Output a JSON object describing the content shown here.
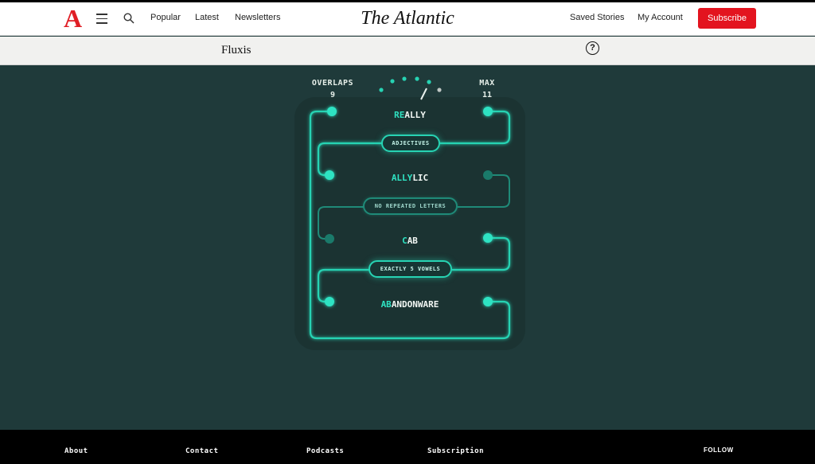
{
  "header": {
    "logo": "A",
    "nav": [
      "Popular",
      "Latest",
      "Newsletters"
    ],
    "brand": "The Atlantic",
    "saved_stories": "Saved Stories",
    "my_account": "My Account",
    "subscribe": "Subscribe"
  },
  "subheader": {
    "title": "Fluxis",
    "help": "?"
  },
  "game": {
    "overlaps_label": "OVERLAPS",
    "overlaps_value": "9",
    "max_label": "MAX",
    "max_value": "11",
    "words": [
      {
        "highlight": "RE",
        "rest": "ALLY"
      },
      {
        "highlight": "ALLY",
        "rest": "LIC"
      },
      {
        "highlight": "C",
        "rest": "AB"
      },
      {
        "highlight": "AB",
        "rest": "ANDONWARE"
      }
    ],
    "rules": [
      "ADJECTIVES",
      "NO REPEATED LETTERS",
      "EXACTLY 5 VOWELS"
    ],
    "colors": {
      "accent": "#27d3b3",
      "background": "#1f3a3a",
      "subscribe": "#e3141f",
      "logo": "#e01e25"
    }
  },
  "footer": {
    "links": [
      "About",
      "Contact",
      "Podcasts",
      "Subscription"
    ],
    "follow": "FOLLOW"
  }
}
